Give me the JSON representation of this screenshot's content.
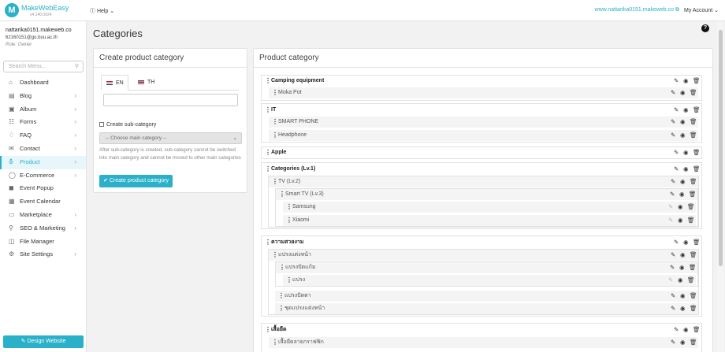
{
  "brand": {
    "name": "MakeWebEasy",
    "version": "v4.140.0924"
  },
  "topbar": {
    "help": "Help",
    "site_link": "www.nattarika0151.makeweb.co",
    "account": "My Account"
  },
  "user": {
    "name": "nattarika0151.makeweb.co",
    "email": "62160151@go.buu.ac.th",
    "role": "Role: Owner"
  },
  "search": {
    "placeholder": "Search Menu..."
  },
  "menu": [
    {
      "label": "Dashboard",
      "icon": "home-icon"
    },
    {
      "label": "Blog",
      "icon": "blog-icon"
    },
    {
      "label": "Album",
      "icon": "album-icon"
    },
    {
      "label": "Forms",
      "icon": "forms-icon"
    },
    {
      "label": "FAQ",
      "icon": "faq-icon"
    },
    {
      "label": "Contact",
      "icon": "contact-icon"
    },
    {
      "label": "Product",
      "icon": "cart-icon"
    },
    {
      "label": "E-Commerce",
      "icon": "tag-icon"
    },
    {
      "label": "Event Popup",
      "icon": "megaphone-icon"
    },
    {
      "label": "Event Calendar",
      "icon": "calendar-icon"
    },
    {
      "label": "Marketplace",
      "icon": "shop-icon"
    },
    {
      "label": "SEO & Marketing",
      "icon": "search-icon"
    },
    {
      "label": "File Manager",
      "icon": "folder-icon"
    },
    {
      "label": "Site Settings",
      "icon": "gear-icon"
    }
  ],
  "design_button": "Design Website",
  "page": {
    "title": "Categories"
  },
  "create_panel": {
    "title": "Create product category",
    "tabs": [
      "EN",
      "TH"
    ],
    "sub_category_label": "Create sub-category",
    "select_placeholder": "-- Choose main category --",
    "hint": "After sub-category is created, sub-category cannot be switched into main category and cannot be moved to other main categories",
    "create_button": "Create product category"
  },
  "category_panel": {
    "title": "Product category",
    "groups": [
      {
        "label": "Camping equipment",
        "children": [
          "Moka Pot"
        ]
      },
      {
        "label": "IT",
        "children": [
          "SMART PHONE",
          "Headphone"
        ]
      },
      {
        "label": "Apple",
        "children": []
      },
      {
        "label": "Categories (Lv.1)",
        "children": [
          "TV (Lv.2)",
          "Smart TV (Lv.3)",
          "Samsung",
          "Xiaomi"
        ]
      },
      {
        "label": "ความสวยงาม",
        "children": [
          "แปรงแต่งหน้า",
          "แปรงปัดแก้ม",
          "แปรง",
          "แปรงปัดตา",
          "ชุดแปรงแต่งหน้า"
        ]
      },
      {
        "label": "เสื้อยืด",
        "children": [
          "เสื้อยืดลายกราฟฟิก"
        ]
      }
    ]
  }
}
